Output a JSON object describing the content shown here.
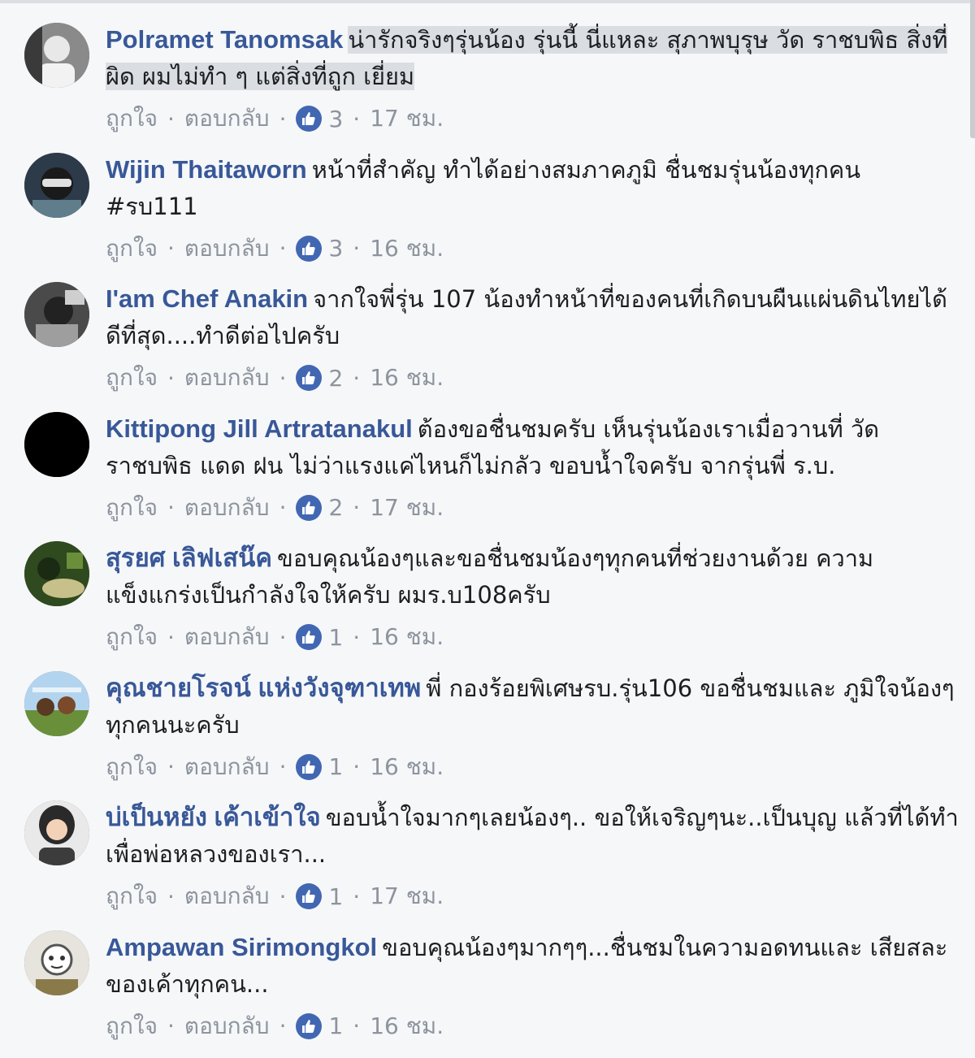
{
  "ui": {
    "like_label": "ถูกใจ",
    "reply_label": "ตอบกลับ",
    "separator": "·",
    "reaction_icon": "thumbs-up-icon",
    "accent_color": "#385898",
    "reaction_color": "#4267b2"
  },
  "comments": [
    {
      "author": "Polramet Tanomsak",
      "text": "น่ารักจริงๆรุ่นน้อง รุ่นนี้ นี่แหละ สุภาพบุรุษ วัด ราชบพิธ สิ่งที่ผิด ผมไม่ทำ ๆ แต่สิ่งที่ถูก เยี่ยม",
      "highlighted": true,
      "reactions": "3",
      "time": "17 ชม."
    },
    {
      "author": "Wijin Thaitaworn",
      "text": "หน้าที่สำคัญ ทำได้อย่างสมภาคภูมิ ชื่นชมรุ่นน้องทุกคน #รบ111",
      "highlighted": false,
      "reactions": "3",
      "time": "16 ชม."
    },
    {
      "author": "I'am Chef Anakin",
      "text": "จากใจพี่รุ่น 107 น้องทำหน้าที่ของคนที่เกิดบนผืนแผ่นดินไทยได้ดีที่สุด....ทำดีต่อไปครับ",
      "highlighted": false,
      "reactions": "2",
      "time": "16 ชม."
    },
    {
      "author": "Kittipong Jill Artratanakul",
      "text": "ต้องขอชื่นชมครับ เห็นรุ่นน้องเราเมื่อวานที่ วัดราชบพิธ แดด ฝน ไม่ว่าแรงแค่ไหนก็ไม่กลัว ขอบน้ำใจครับ จากรุ่นพี่ ร.บ.",
      "highlighted": false,
      "reactions": "2",
      "time": "17 ชม."
    },
    {
      "author": "สุรยศ เลิฟเสน๊ค",
      "text": "ขอบคุณน้องๆและขอชื่นชมน้องๆทุกคนที่ช่วยงานด้วย ความแข็งแกร่งเป็นกำลังใจให้ครับ ผมร.บ108ครับ",
      "highlighted": false,
      "reactions": "1",
      "time": "16 ชม."
    },
    {
      "author": "คุณชายโรจน์ แห่งวังจุฑาเทพ",
      "text": "พี่ กองร้อยพิเศษรบ.รุ่น106 ขอชื่นชมและ ภูมิใจน้องๆทุกคนนะครับ",
      "highlighted": false,
      "reactions": "1",
      "time": "16 ชม."
    },
    {
      "author": "บ่เป็นหยัง เค้าเข้าใจ",
      "text": "ขอบน้ำใจมากๆเลยน้องๆ.. ขอให้เจริญๆนะ..เป็นบุญ แล้วที่ได้ทำเพื่อพ่อหลวงของเรา...",
      "highlighted": false,
      "reactions": "1",
      "time": "17 ชม."
    },
    {
      "author": "Ampawan Sirimongkol",
      "text": "ขอบคุณน้องๆมากๆๆ...ชื่นชมในความอดทนและ เสียสละของเค้าทุกคน...",
      "highlighted": false,
      "reactions": "1",
      "time": "16 ชม."
    }
  ]
}
